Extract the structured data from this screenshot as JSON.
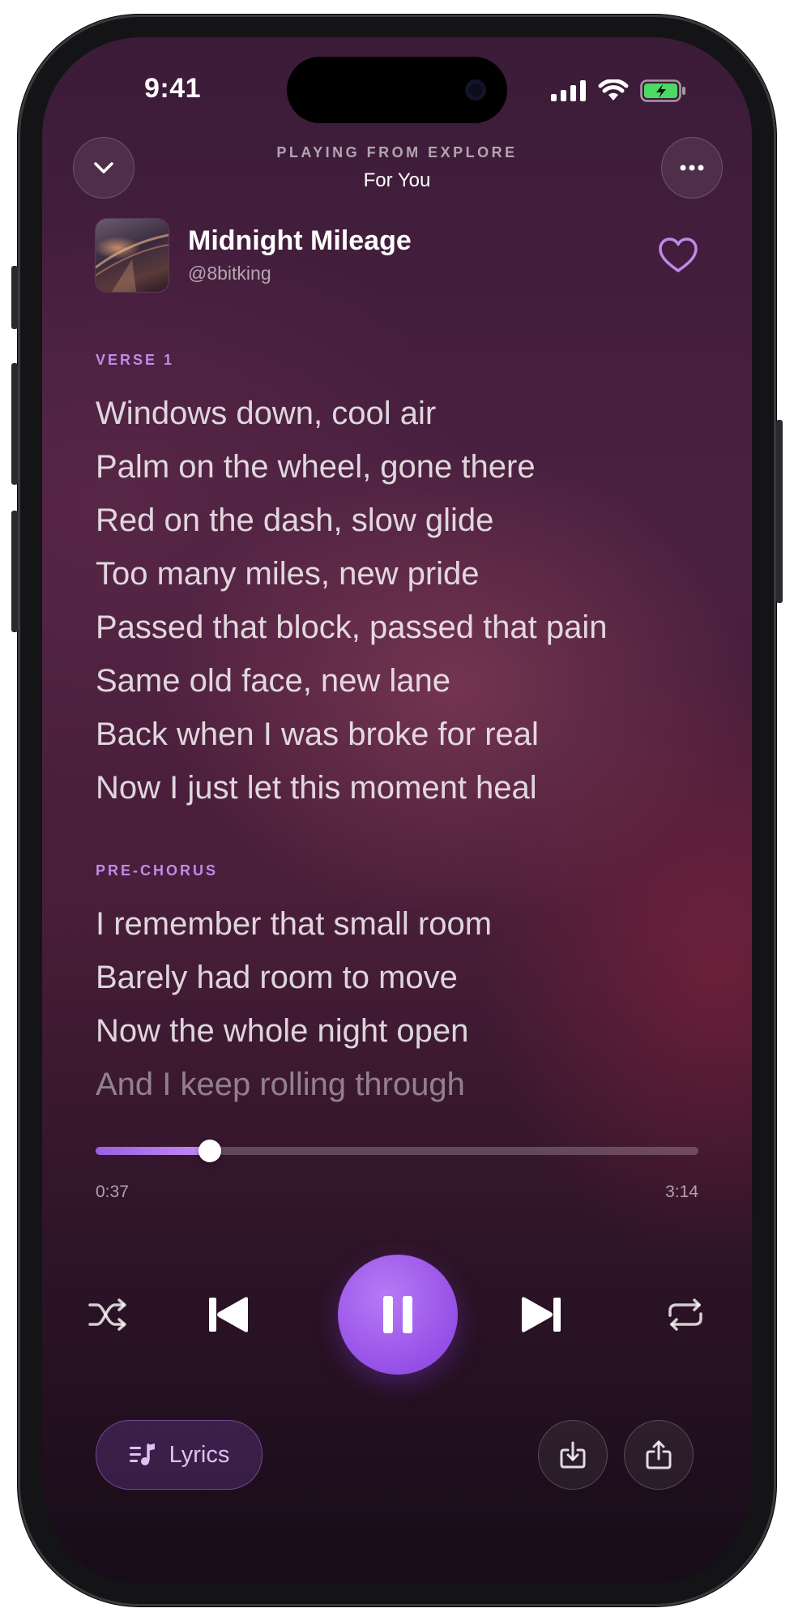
{
  "status_bar": {
    "time": "9:41"
  },
  "header": {
    "context_label": "PLAYING FROM EXPLORE",
    "context_title": "For You"
  },
  "track": {
    "title": "Midnight Mileage",
    "artist": "@8bitking",
    "liked": false
  },
  "lyrics": {
    "sections": [
      {
        "label": "VERSE 1",
        "lines": [
          "Windows down, cool air",
          "Palm on the wheel, gone there",
          "Red on the dash, slow glide",
          "Too many miles, new pride",
          "Passed that block, passed that pain",
          "Same old face, new lane",
          "Back when I was broke for real",
          "Now I just let this moment heal"
        ]
      },
      {
        "label": "PRE-CHORUS",
        "lines": [
          "I remember that small room",
          "Barely had room to move",
          "Now the whole night open",
          "And I keep rolling through"
        ]
      }
    ]
  },
  "playback": {
    "elapsed": "0:37",
    "duration": "3:14",
    "progress_fraction": 0.19,
    "state": "playing"
  },
  "bottom": {
    "lyrics_button_label": "Lyrics"
  },
  "colors": {
    "accent": "#9b5de5",
    "accent_light": "#c08ae8"
  },
  "icons": {
    "collapse": "chevron-down-icon",
    "more": "more-dots-icon",
    "like": "heart-icon",
    "shuffle": "shuffle-icon",
    "previous": "previous-icon",
    "pause": "pause-icon",
    "next": "next-icon",
    "repeat": "repeat-icon",
    "lyrics": "lyrics-icon",
    "download": "download-icon",
    "share": "share-icon"
  }
}
